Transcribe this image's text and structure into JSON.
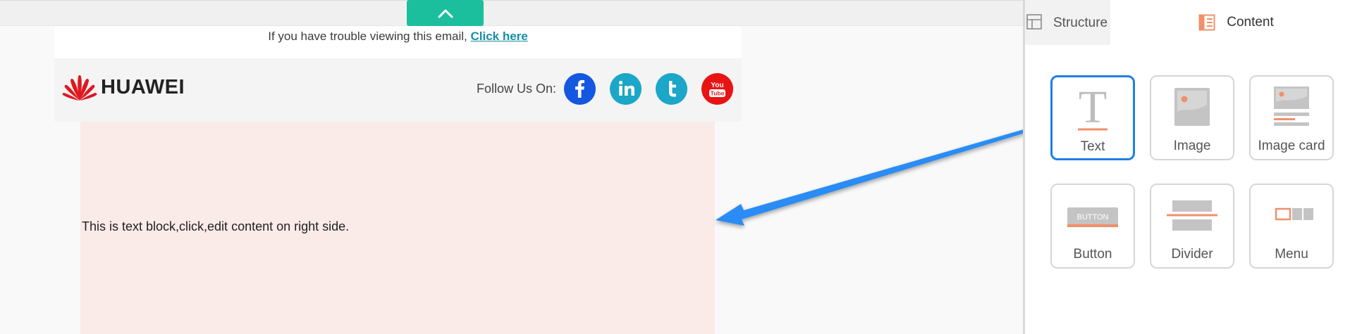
{
  "canvas": {
    "collapse_button": {
      "icon": "chevron-up-icon"
    },
    "email": {
      "preheader": {
        "text": "If you have trouble viewing this email,",
        "link": "Click here"
      },
      "header": {
        "logo_text": "HUAWEI",
        "follow_label": "Follow Us On:",
        "social": [
          {
            "name": "facebook",
            "icon": "facebook-icon",
            "color": "#1457e0"
          },
          {
            "name": "linkedin",
            "icon": "linkedin-icon",
            "color": "#1ba7c7"
          },
          {
            "name": "tumblr",
            "icon": "t-icon",
            "color": "#1ba7c7"
          },
          {
            "name": "youtube",
            "icon": "youtube-icon",
            "color": "#e81414",
            "text_top": "You",
            "text_bottom": "Tube"
          }
        ]
      },
      "text_block": {
        "content": "This is text block,click,edit content on right side."
      }
    }
  },
  "panel": {
    "tabs": [
      {
        "label": "Structure",
        "icon": "structure-icon",
        "active": false
      },
      {
        "label": "Content",
        "icon": "content-icon",
        "active": true
      }
    ],
    "blocks": [
      {
        "label": "Text",
        "icon": "text-block-icon",
        "selected": true
      },
      {
        "label": "Image",
        "icon": "image-block-icon",
        "selected": false
      },
      {
        "label": "Image card",
        "icon": "image-card-icon",
        "selected": false
      },
      {
        "label": "Button",
        "icon": "button-block-icon",
        "selected": false,
        "inner_text": "BUTTON"
      },
      {
        "label": "Divider",
        "icon": "divider-block-icon",
        "selected": false
      },
      {
        "label": "Menu",
        "icon": "menu-block-icon",
        "selected": false
      }
    ]
  },
  "colors": {
    "accent_teal": "#1cbf9d",
    "selection_blue": "#1e7ee8",
    "arrow_blue": "#2a8cf4",
    "icon_orange": "#f0906a",
    "text_block_bg": "#faebe8",
    "link": "#168da8"
  }
}
